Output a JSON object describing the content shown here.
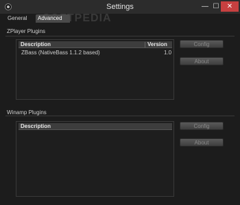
{
  "window": {
    "title": "Settings",
    "minimize_glyph": "—",
    "maximize_glyph": "☐",
    "close_glyph": "✕"
  },
  "tabs": [
    {
      "label": "General"
    },
    {
      "label": "Advanced",
      "selected": true
    }
  ],
  "watermark": "SOFTPEDIA",
  "zplayer": {
    "section_label": "ZPlayer Plugins",
    "columns": {
      "description": "Description",
      "version": "Version"
    },
    "rows": [
      {
        "description": "ZBass (NativeBass 1.1.2 based)",
        "version": "1.0"
      }
    ],
    "config_label": "Config",
    "about_label": "About"
  },
  "winamp": {
    "section_label": "Winamp Plugins",
    "columns": {
      "description": "Description"
    },
    "rows": [],
    "config_label": "Config",
    "about_label": "About"
  },
  "colors": {
    "background": "#1c1c1c",
    "titlebar": "#2c2c2c",
    "close_button": "#c74040",
    "selected_tab": "#4a4a4a"
  }
}
